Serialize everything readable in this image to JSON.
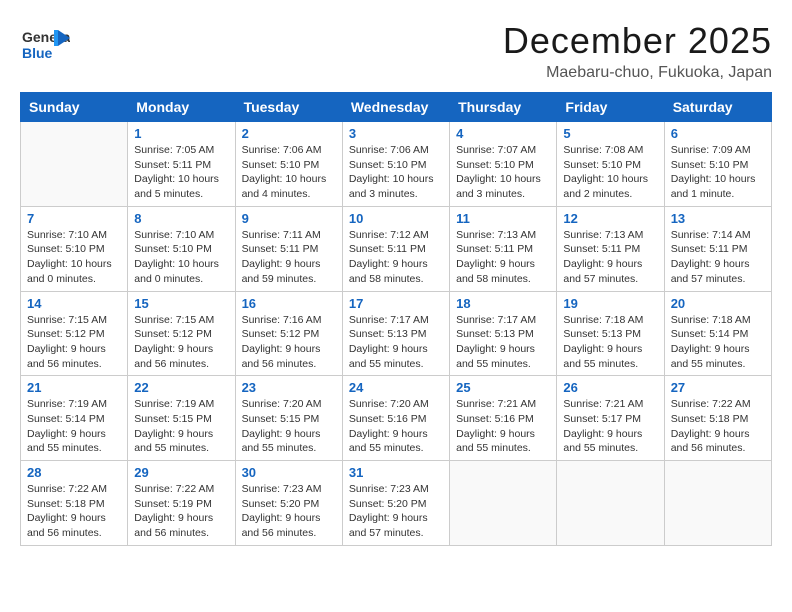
{
  "header": {
    "logo": {
      "general": "General",
      "blue": "Blue"
    },
    "title": "December 2025",
    "location": "Maebaru-chuo, Fukuoka, Japan"
  },
  "days_of_week": [
    "Sunday",
    "Monday",
    "Tuesday",
    "Wednesday",
    "Thursday",
    "Friday",
    "Saturday"
  ],
  "weeks": [
    [
      {
        "day": null
      },
      {
        "day": 1,
        "sunrise": "7:05 AM",
        "sunset": "5:11 PM",
        "daylight": "10 hours and 5 minutes."
      },
      {
        "day": 2,
        "sunrise": "7:06 AM",
        "sunset": "5:10 PM",
        "daylight": "10 hours and 4 minutes."
      },
      {
        "day": 3,
        "sunrise": "7:06 AM",
        "sunset": "5:10 PM",
        "daylight": "10 hours and 3 minutes."
      },
      {
        "day": 4,
        "sunrise": "7:07 AM",
        "sunset": "5:10 PM",
        "daylight": "10 hours and 3 minutes."
      },
      {
        "day": 5,
        "sunrise": "7:08 AM",
        "sunset": "5:10 PM",
        "daylight": "10 hours and 2 minutes."
      },
      {
        "day": 6,
        "sunrise": "7:09 AM",
        "sunset": "5:10 PM",
        "daylight": "10 hours and 1 minute."
      }
    ],
    [
      {
        "day": 7,
        "sunrise": "7:10 AM",
        "sunset": "5:10 PM",
        "daylight": "10 hours and 0 minutes."
      },
      {
        "day": 8,
        "sunrise": "7:10 AM",
        "sunset": "5:10 PM",
        "daylight": "10 hours and 0 minutes."
      },
      {
        "day": 9,
        "sunrise": "7:11 AM",
        "sunset": "5:11 PM",
        "daylight": "9 hours and 59 minutes."
      },
      {
        "day": 10,
        "sunrise": "7:12 AM",
        "sunset": "5:11 PM",
        "daylight": "9 hours and 58 minutes."
      },
      {
        "day": 11,
        "sunrise": "7:13 AM",
        "sunset": "5:11 PM",
        "daylight": "9 hours and 58 minutes."
      },
      {
        "day": 12,
        "sunrise": "7:13 AM",
        "sunset": "5:11 PM",
        "daylight": "9 hours and 57 minutes."
      },
      {
        "day": 13,
        "sunrise": "7:14 AM",
        "sunset": "5:11 PM",
        "daylight": "9 hours and 57 minutes."
      }
    ],
    [
      {
        "day": 14,
        "sunrise": "7:15 AM",
        "sunset": "5:12 PM",
        "daylight": "9 hours and 56 minutes."
      },
      {
        "day": 15,
        "sunrise": "7:15 AM",
        "sunset": "5:12 PM",
        "daylight": "9 hours and 56 minutes."
      },
      {
        "day": 16,
        "sunrise": "7:16 AM",
        "sunset": "5:12 PM",
        "daylight": "9 hours and 56 minutes."
      },
      {
        "day": 17,
        "sunrise": "7:17 AM",
        "sunset": "5:13 PM",
        "daylight": "9 hours and 55 minutes."
      },
      {
        "day": 18,
        "sunrise": "7:17 AM",
        "sunset": "5:13 PM",
        "daylight": "9 hours and 55 minutes."
      },
      {
        "day": 19,
        "sunrise": "7:18 AM",
        "sunset": "5:13 PM",
        "daylight": "9 hours and 55 minutes."
      },
      {
        "day": 20,
        "sunrise": "7:18 AM",
        "sunset": "5:14 PM",
        "daylight": "9 hours and 55 minutes."
      }
    ],
    [
      {
        "day": 21,
        "sunrise": "7:19 AM",
        "sunset": "5:14 PM",
        "daylight": "9 hours and 55 minutes."
      },
      {
        "day": 22,
        "sunrise": "7:19 AM",
        "sunset": "5:15 PM",
        "daylight": "9 hours and 55 minutes."
      },
      {
        "day": 23,
        "sunrise": "7:20 AM",
        "sunset": "5:15 PM",
        "daylight": "9 hours and 55 minutes."
      },
      {
        "day": 24,
        "sunrise": "7:20 AM",
        "sunset": "5:16 PM",
        "daylight": "9 hours and 55 minutes."
      },
      {
        "day": 25,
        "sunrise": "7:21 AM",
        "sunset": "5:16 PM",
        "daylight": "9 hours and 55 minutes."
      },
      {
        "day": 26,
        "sunrise": "7:21 AM",
        "sunset": "5:17 PM",
        "daylight": "9 hours and 55 minutes."
      },
      {
        "day": 27,
        "sunrise": "7:22 AM",
        "sunset": "5:18 PM",
        "daylight": "9 hours and 56 minutes."
      }
    ],
    [
      {
        "day": 28,
        "sunrise": "7:22 AM",
        "sunset": "5:18 PM",
        "daylight": "9 hours and 56 minutes."
      },
      {
        "day": 29,
        "sunrise": "7:22 AM",
        "sunset": "5:19 PM",
        "daylight": "9 hours and 56 minutes."
      },
      {
        "day": 30,
        "sunrise": "7:23 AM",
        "sunset": "5:20 PM",
        "daylight": "9 hours and 56 minutes."
      },
      {
        "day": 31,
        "sunrise": "7:23 AM",
        "sunset": "5:20 PM",
        "daylight": "9 hours and 57 minutes."
      },
      {
        "day": null
      },
      {
        "day": null
      },
      {
        "day": null
      }
    ]
  ]
}
